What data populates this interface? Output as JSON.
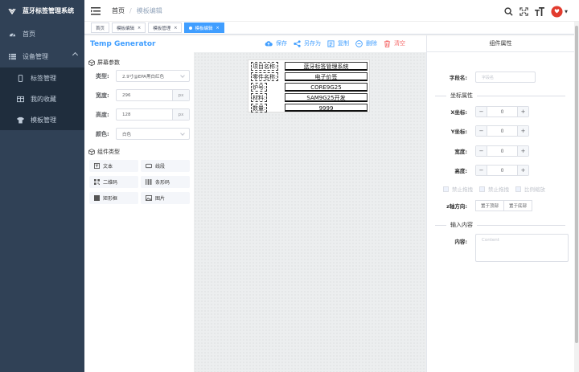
{
  "app": {
    "title": "蓝牙标签管理系统"
  },
  "sidebar": {
    "items": [
      {
        "label": "首页",
        "icon": "dashboard-icon"
      },
      {
        "label": "设备管理",
        "icon": "list-icon"
      }
    ],
    "sub_items": [
      {
        "label": "标签管理",
        "icon": "phone-icon"
      },
      {
        "label": "我的收藏",
        "icon": "table-icon"
      },
      {
        "label": "模板管理",
        "icon": "shirt-icon"
      }
    ]
  },
  "navbar": {
    "breadcrumb_home": "首页",
    "breadcrumb_sep": "/",
    "breadcrumb_current": "模板编辑"
  },
  "tags": [
    {
      "label": "首页"
    },
    {
      "label": "模板编辑"
    },
    {
      "label": "模板管理"
    },
    {
      "label": "模板编辑"
    }
  ],
  "editor": {
    "title": "Temp Generator",
    "toolbar": {
      "save": "保存",
      "save_as": "另存为",
      "copy": "复制",
      "delete": "删除",
      "clear": "清空"
    }
  },
  "screen_params": {
    "title": "屏幕参数",
    "type_label": "类型:",
    "type_value": "2.9寸@EPA黑白红色",
    "width_label": "宽度:",
    "width_value": "296",
    "width_unit": "px",
    "height_label": "高度:",
    "height_value": "128",
    "height_unit": "px",
    "color_label": "颜色:",
    "color_value": "白色"
  },
  "component_types": {
    "title": "组件类型",
    "items": [
      "文本",
      "线段",
      "二维码",
      "条形码",
      "矩形框",
      "图片"
    ]
  },
  "label_rows": [
    {
      "name": "项目名称:",
      "value": "蓝牙标签管理系统"
    },
    {
      "name": "零件名称:",
      "value": "电子价签"
    },
    {
      "name": "炉号:",
      "value": "CORE9G25"
    },
    {
      "name": "材料:",
      "value": "SAM9G25开发"
    },
    {
      "name": "数量:",
      "value": "9999"
    }
  ],
  "props": {
    "title": "组件属性",
    "field_label": "字段名:",
    "field_placeholder": "字段名",
    "coord_title": "坐标属性",
    "x_label": "X坐标:",
    "x_value": "0",
    "y_label": "Y坐标:",
    "y_value": "0",
    "w_label": "宽度:",
    "w_value": "0",
    "h_label": "高度:",
    "h_value": "0",
    "checks": [
      "禁止拖拽",
      "禁止拖拽",
      "比例缩放"
    ],
    "z_label": "z轴方向:",
    "z_top": "置于顶部",
    "z_bottom": "置于底部",
    "content_title": "输入内容",
    "content_label": "内容:",
    "content_placeholder": "Content"
  },
  "colors": {
    "sidebar": "#304156",
    "accent": "#409EFF",
    "danger": "#F56C6C"
  }
}
